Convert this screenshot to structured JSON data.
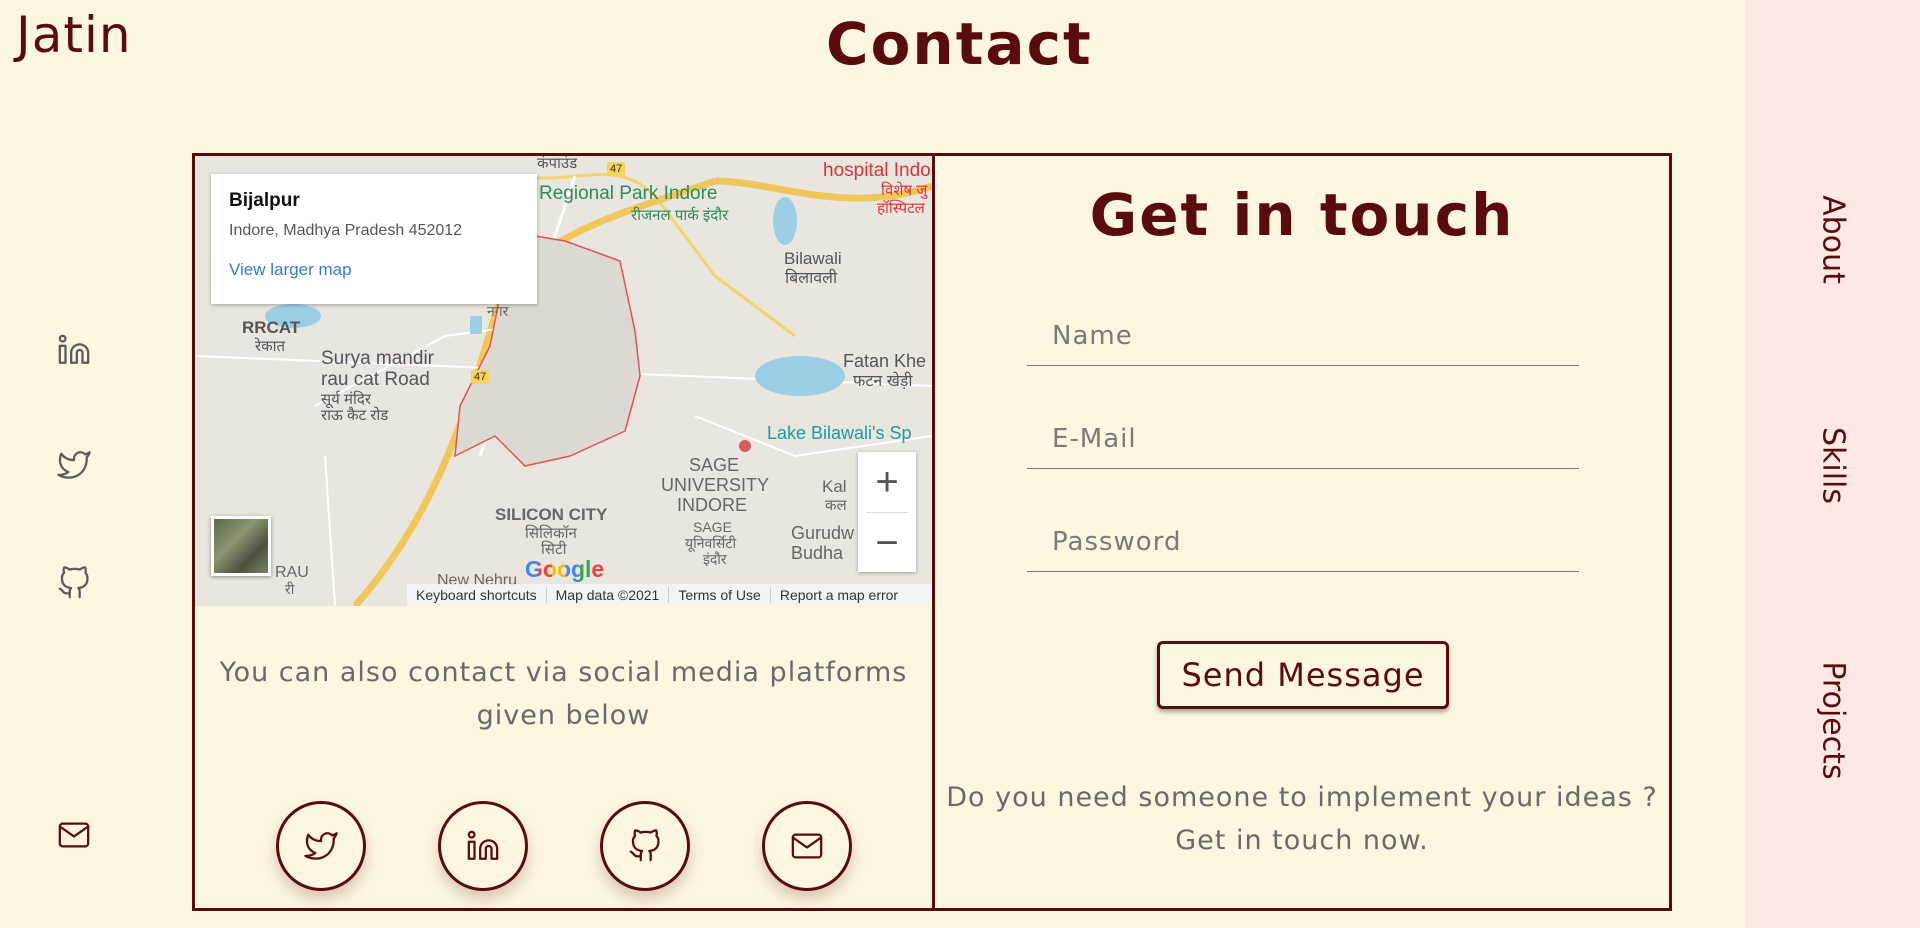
{
  "brand": "Jatin",
  "page_title": "Contact",
  "left_social": [
    {
      "icon": "linkedin-icon"
    },
    {
      "icon": "twitter-icon"
    },
    {
      "icon": "github-icon"
    },
    {
      "icon": "mail-icon"
    }
  ],
  "right_nav": [
    {
      "label": "About"
    },
    {
      "label": "Skills"
    },
    {
      "label": "Projects"
    }
  ],
  "map": {
    "place_title": "Bijalpur",
    "place_address": "Indore, Madhya Pradesh 452012",
    "view_larger": "View larger map",
    "zoom_in": "+",
    "zoom_out": "−",
    "footer": {
      "shortcuts": "Keyboard shortcuts",
      "data": "Map data ©2021",
      "terms": "Terms of Use",
      "report": "Report a map error"
    },
    "logo": "Google",
    "labels": {
      "regional_park": "Regional Park Indore",
      "regional_park_hi": "रीजनल पार्क इंदौर",
      "kampound": "कंपाउंड",
      "hospital": "hospital Indo",
      "hospital_hi": "विशेष जु",
      "hospital_hi2": "हॉस्पिटल",
      "bilawali": "Bilawali",
      "bilawali_hi": "बिलावली",
      "rrcat": "RRCAT",
      "rrcat_hi": "रेकात",
      "surya": "Surya mandir",
      "surya2": "rau cat Road",
      "surya_hi": "सूर्य मंदिर",
      "surya_hi2": "राऊ कैट रोड",
      "fatan": "Fatan Khe",
      "fatan_hi": "फटन खेड़ी",
      "lake": "Lake Bilawali's Sp",
      "sage": "SAGE",
      "sage2": "UNIVERSITY",
      "sage3": "INDORE",
      "sage_hi": "SAGE",
      "sage_hi2": "यूनिवर्सिटी",
      "sage_hi3": "इंदौर",
      "silicon": "SILICON CITY",
      "silicon_hi": "सिलिकॉन",
      "silicon_hi2": "सिटी",
      "gurudw": "Gurudw",
      "budha": "Budha",
      "rau": "RAU",
      "rau_hi": "री",
      "nagar_hi": "नगर",
      "ra": "RA",
      "new_nehru": "New Nehru",
      "kal": "Kal",
      "kal_hi": "कल",
      "road_47": "47",
      "rau_cat_rd": "Rau-CAT Rd"
    }
  },
  "social_note": "You can also contact via social media platforms given below",
  "circle_social": [
    {
      "icon": "twitter-icon"
    },
    {
      "icon": "linkedin-icon"
    },
    {
      "icon": "github-icon"
    },
    {
      "icon": "mail-icon"
    }
  ],
  "form": {
    "title": "Get in touch",
    "name_placeholder": "Name",
    "email_placeholder": "E-Mail",
    "password_placeholder": "Password",
    "submit_label": "Send Message",
    "note": "Do you need someone to implement your ideas ? Get in touch now."
  },
  "colors": {
    "background": "#fcf6e1",
    "accent": "#5a0b0b",
    "rail": "#fde9e4",
    "muted_text": "#6a6a6a"
  }
}
